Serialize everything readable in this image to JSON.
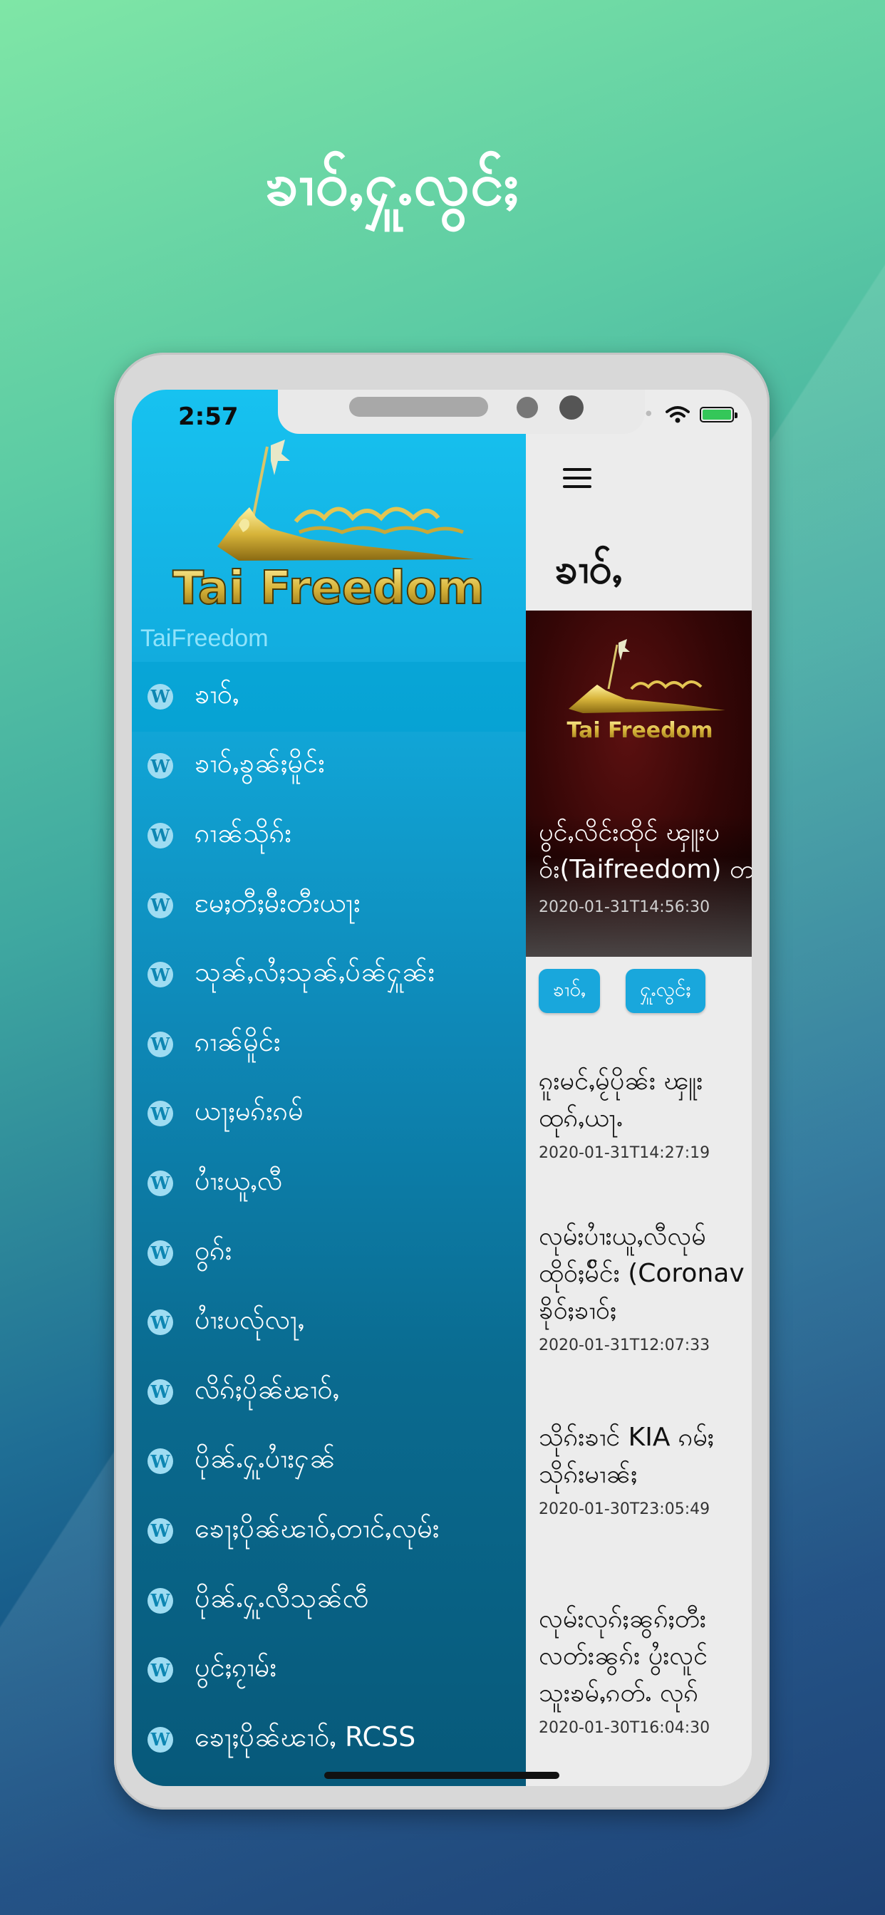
{
  "headline": "ၶၢဝ်ႇႁူႉလွင်ႈ",
  "status_bar": {
    "time": "2:57"
  },
  "drawer": {
    "logo_text": "Tai Freedom",
    "site_name": "TaiFreedom",
    "items": [
      {
        "label": "ၶၢဝ်ႇ",
        "active": true
      },
      {
        "label": "ၶၢဝ်ႇၶွၼ်ႈမိူင်း"
      },
      {
        "label": "ၵၢၼ်သိုၵ်း"
      },
      {
        "label": "မႄႈတီႈမီးတီးယႃး"
      },
      {
        "label": "သုၼ်ႇလႆႈသုၼ်ႇပ်ၼ်ႁူၼ်း"
      },
      {
        "label": "ၵၢၼ်မိူင်း"
      },
      {
        "label": "ယႃႈမၵ်းၵမ်"
      },
      {
        "label": "ပၢႆးယူႇလီ"
      },
      {
        "label": "ဝွၵ်း"
      },
      {
        "label": "ပၢႆးပလ်ုလႃႇ"
      },
      {
        "label": "လိၵ်ႈပိုၼ်ၽၢဝ်ႇ"
      },
      {
        "label": "ပိုၼ်ႉႁူႉပၢႆးႁၼ်"
      },
      {
        "label": "ၶေႃႈပိုၼ်ၽၢဝ်ႇတၢင်ႇလုမ်း"
      },
      {
        "label": "ပိုၼ်ႉႁူႉလီသုၼ်ၸဵ"
      },
      {
        "label": "ပွင်ႈၵႂၢမ်း"
      },
      {
        "label": "ၶေႃႈပိုၼ်ၽၢဝ်ႇ RCSS"
      }
    ]
  },
  "content": {
    "page_title": "ၶၢဝ်ႇ",
    "hero": {
      "logo_text": "Tai Freedom",
      "title_line1": "ပွင်ႇလိင်းထိုင် ၾူးပ",
      "title_line2": "ဝ်း(Taifreedom) တ",
      "date": "2020-01-31T14:56:30"
    },
    "chips": [
      "ၶၢဝ်ႇ",
      "ႁူႉလွင်ႈ"
    ],
    "articles": [
      {
        "title_lines": [
          "ၵူးမင်ႇမႂ်ပိုၼ်း ၾူး",
          "ထုၵ်ႇယႃႉ"
        ],
        "date": "2020-01-31T14:27:19"
      },
      {
        "title_lines": [
          "လုမ်းပၢႆးယူႇလီလုမ်",
          "ထိုဝ်ႈမ်ိင်း (Coronav",
          "ၶိုဝ်ႈၶၢဝ်ႈ"
        ],
        "date": "2020-01-31T12:07:33"
      },
      {
        "title_lines": [
          "သိုၵ်းၶၢင် KIA ၵမ်ႈ"
        ],
        "title_lines_extra": [
          "သိုၵ်းမၢၼ်ႈ"
        ],
        "date": "2020-01-30T23:05:49"
      },
      {
        "title_lines": [
          "လုမ်းလုၵ်ႈၼွၵ်ႈတီး",
          "လတ်းၼွၵ်း ပွႆးလူင်",
          "သူးၶမ်ႇၵတ်ႉ လုၵ်"
        ],
        "date": "2020-01-30T16:04:30"
      }
    ]
  },
  "colors": {
    "accent": "#19a7dc",
    "drawer_top": "#17c2f0",
    "drawer_bottom": "#07597a",
    "battery": "#34c759"
  },
  "icons": [
    "wordpress-icon",
    "hamburger-menu-icon",
    "wifi-icon",
    "battery-icon"
  ]
}
